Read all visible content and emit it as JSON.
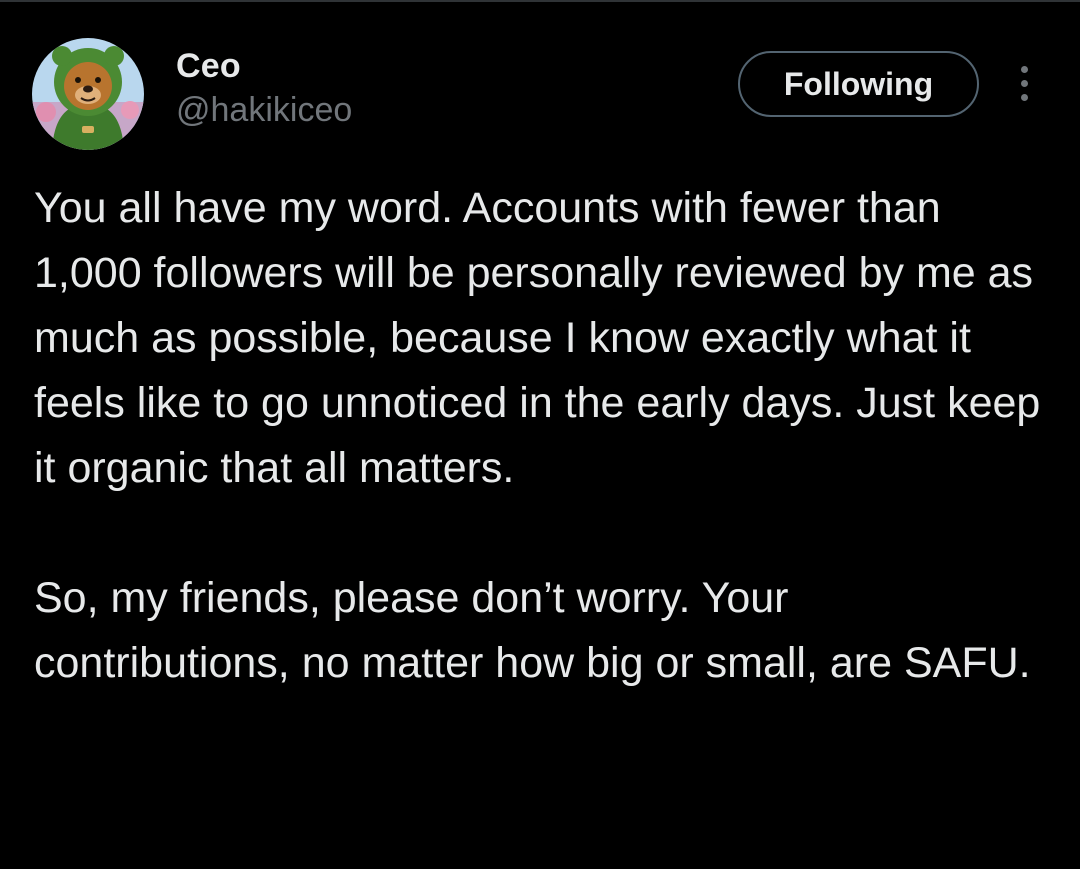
{
  "author": {
    "display_name": "Ceo",
    "handle": "@hakikiceo",
    "avatar_icon": "bear-in-green-hoodie-avatar"
  },
  "actions": {
    "follow_label": "Following",
    "more_icon": "more-options-icon"
  },
  "tweet": {
    "paragraphs": [
      "You all have my word. Accounts with fewer than 1,000 followers will be personally reviewed by me as much as possible, because I know exactly what it feels like to go unnoticed in the early days. Just keep it organic that all matters.",
      "So, my friends, please don’t worry. Your contributions, no matter how big or small, are SAFU."
    ]
  },
  "colors": {
    "background": "#000000",
    "primary_text": "#e7e9ea",
    "secondary_text": "#71767b",
    "button_border": "#536471",
    "avatar_hoodie": "#3e7a2c"
  }
}
